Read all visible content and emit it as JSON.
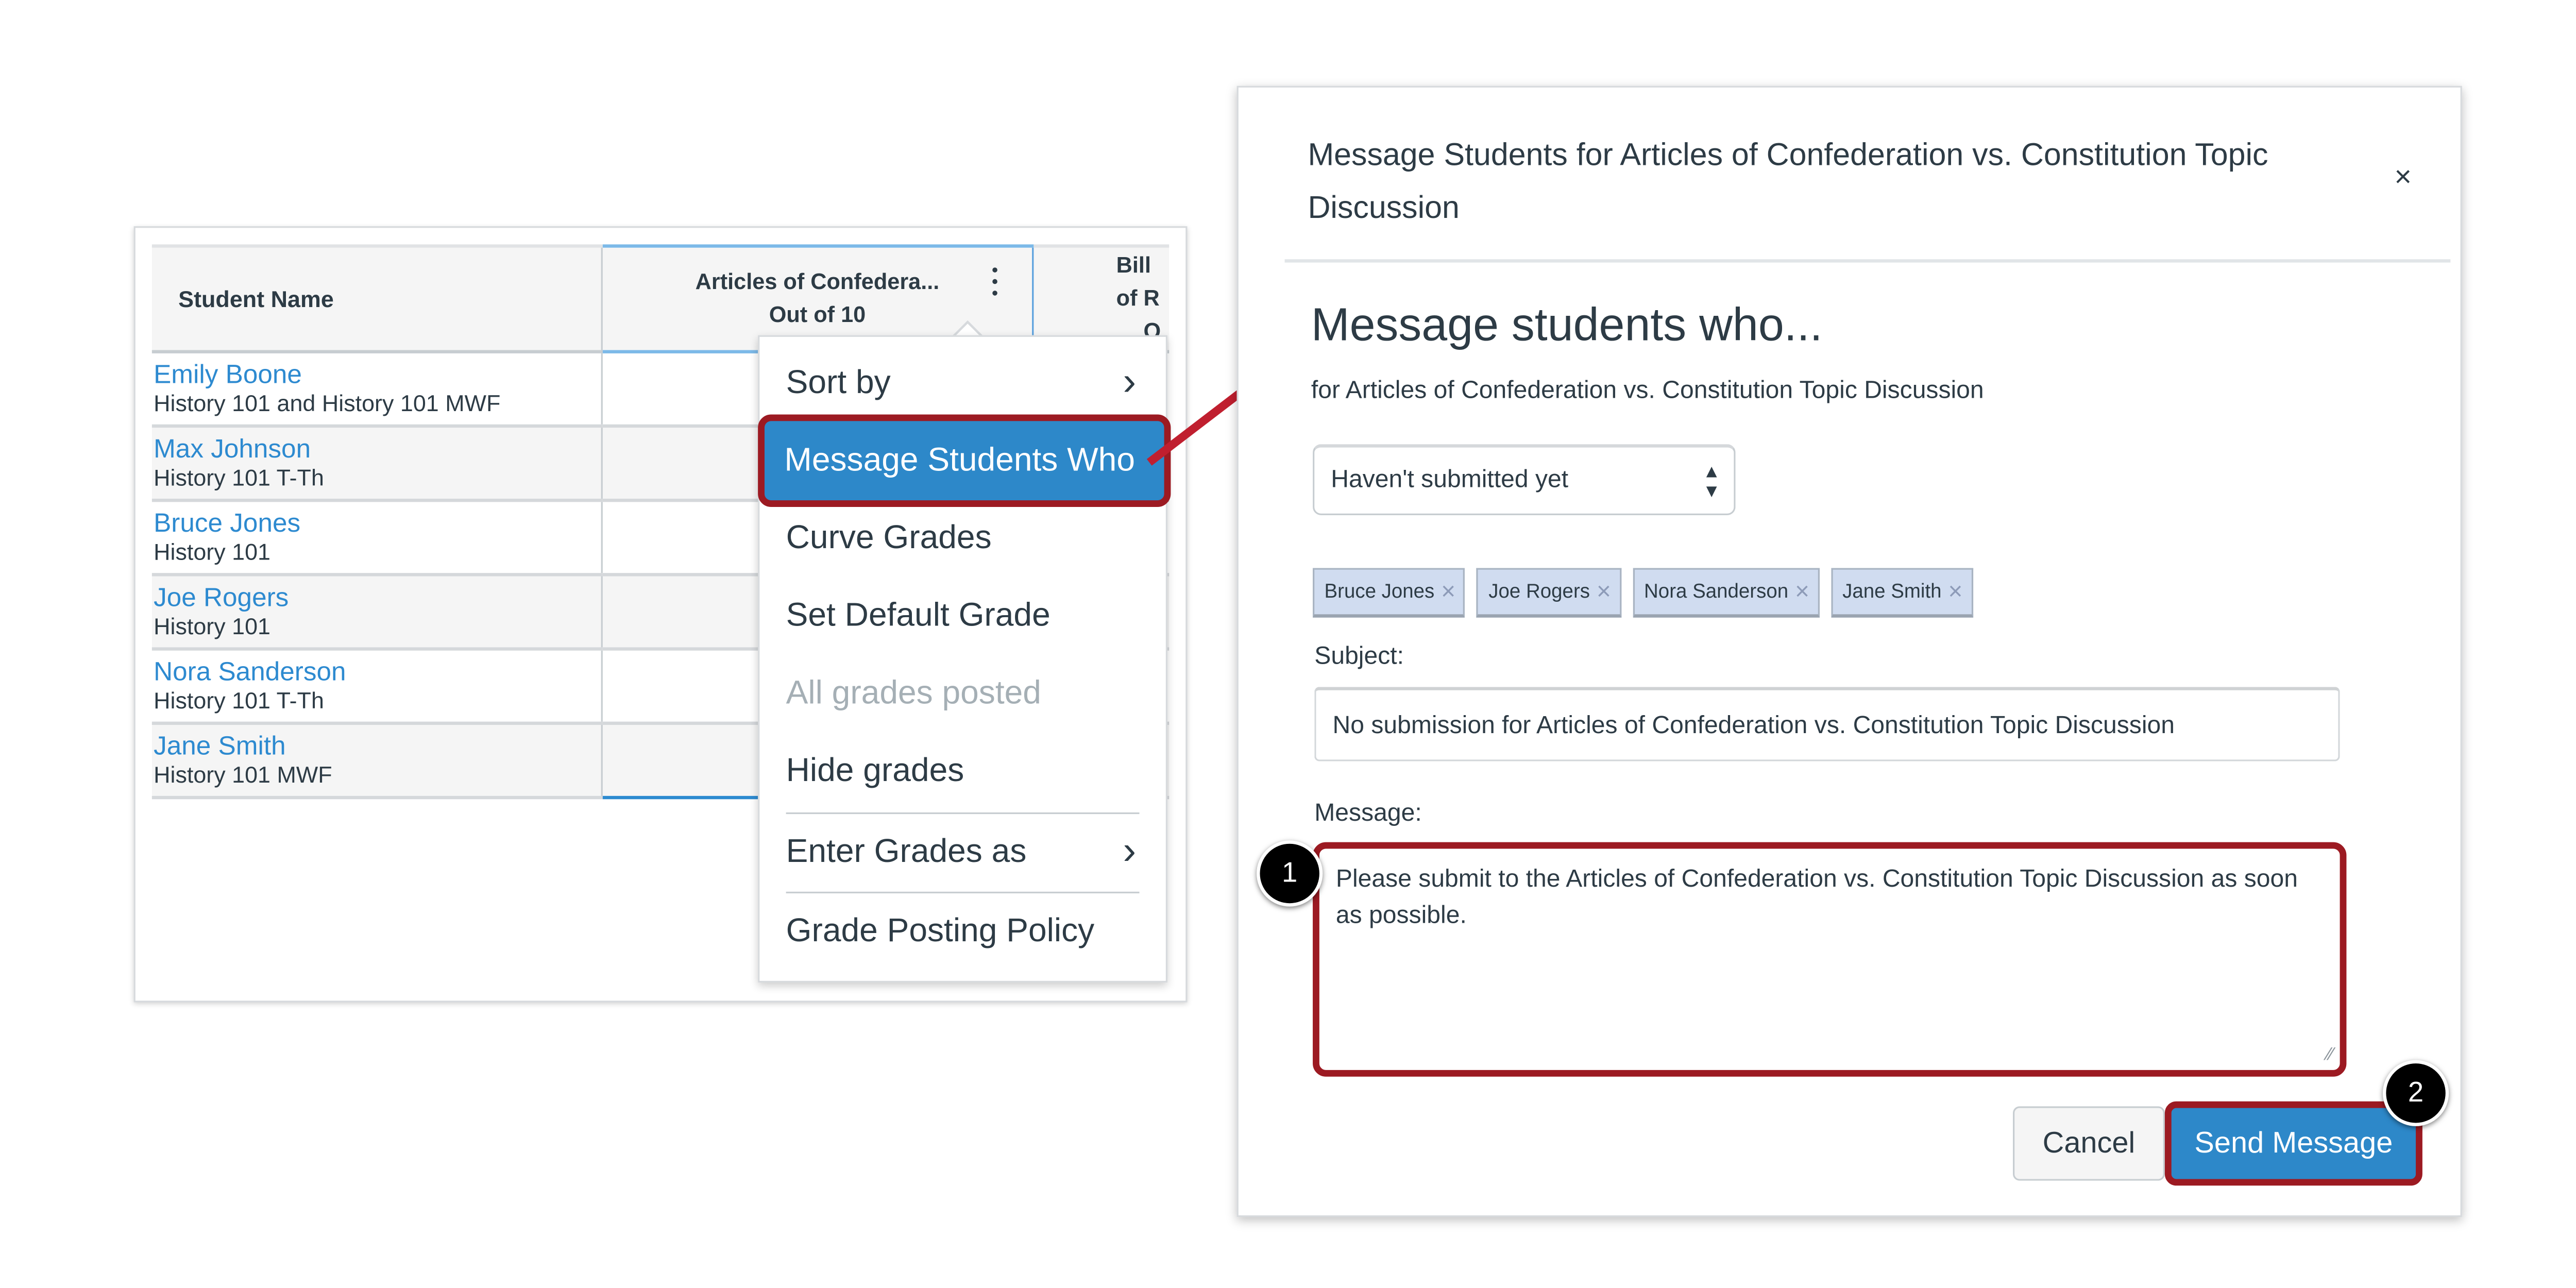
{
  "gradebook": {
    "columns": {
      "student_name": "Student Name",
      "assignment_title": "Articles of Confedera...",
      "assignment_points": "Out of 10",
      "next_title": "Bill of R",
      "next_points": "O"
    },
    "students": [
      {
        "name": "Emily Boone",
        "section": "History 101 and History 101 MWF"
      },
      {
        "name": "Max Johnson",
        "section": "History 101 T-Th"
      },
      {
        "name": "Bruce Jones",
        "section": "History 101"
      },
      {
        "name": "Joe Rogers",
        "section": "History 101"
      },
      {
        "name": "Nora Sanderson",
        "section": "History 101 T-Th"
      },
      {
        "name": "Jane Smith",
        "section": "History 101 MWF"
      }
    ]
  },
  "column_menu": {
    "items": [
      {
        "label": "Sort by",
        "submenu": true
      },
      {
        "label": "Message Students Who",
        "highlighted": true
      },
      {
        "label": "Curve Grades"
      },
      {
        "label": "Set Default Grade"
      },
      {
        "label": "All grades posted",
        "disabled": true
      },
      {
        "label": "Hide grades"
      },
      {
        "label": "Enter Grades as",
        "submenu": true
      },
      {
        "label": "Grade Posting Policy"
      }
    ],
    "chevron": "›"
  },
  "modal": {
    "title": "Message Students for Articles of Confederation vs. Constitution Topic Discussion",
    "close_icon": "×",
    "heading": "Message students who...",
    "subheading": "for Articles of Confederation vs. Constitution Topic Discussion",
    "criteria_selected": "Haven't submitted yet",
    "recipients": [
      "Bruce Jones",
      "Joe Rogers",
      "Nora Sanderson",
      "Jane Smith"
    ],
    "remove_icon": "×",
    "subject_label": "Subject:",
    "subject_value": "No submission for Articles of Confederation vs. Constitution Topic Discussion",
    "message_label": "Message:",
    "message_value": "Please submit to the Articles of Confederation vs. Constitution Topic Discussion as soon as possible.",
    "cancel_label": "Cancel",
    "send_label": "Send Message"
  },
  "annotations": {
    "step1": "1",
    "step2": "2"
  },
  "colors": {
    "link": "#2d8ad0",
    "highlight_blue": "#2d88c9",
    "callout_red": "#9c1a22",
    "arrow_red": "#c01f2f",
    "text": "#2d3b45",
    "chip_bg": "#d0dcf0"
  }
}
